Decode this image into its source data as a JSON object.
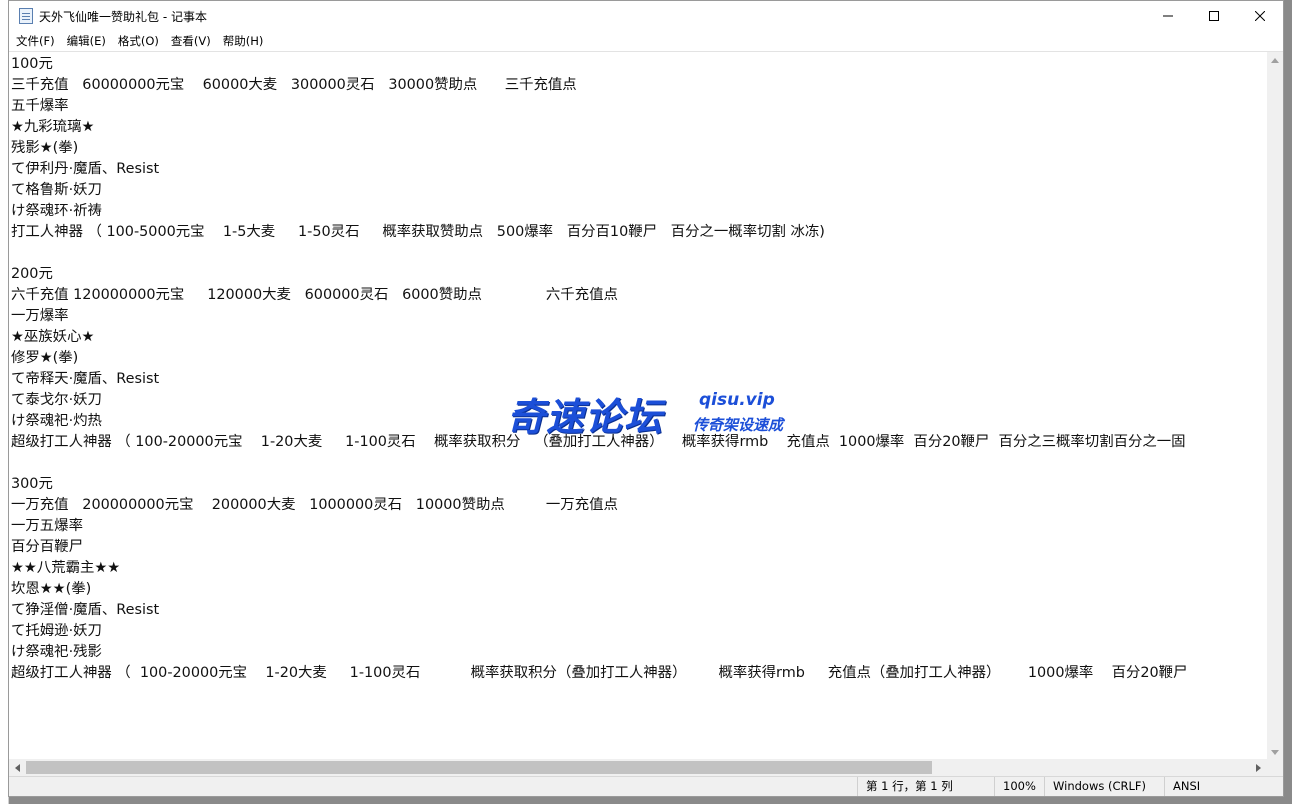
{
  "window": {
    "title": "天外飞仙唯一赞助礼包 - 记事本",
    "icon": "notepad-icon"
  },
  "menu": [
    "文件(F)",
    "编辑(E)",
    "格式(O)",
    "查看(V)",
    "帮助(H)"
  ],
  "editor": {
    "lines": [
      "100元",
      "三千充值   60000000元宝    60000大麦   300000灵石   30000赞助点      三千充值点",
      "五千爆率",
      "★九彩琉璃★",
      "残影★(拳)",
      "て伊利丹·魔盾、Resist",
      "て格鲁斯·妖刀",
      "け祭魂环·祈祷",
      "打工人神器 （ 100-5000元宝    1-5大麦     1-50灵石     概率获取赞助点   500爆率   百分百10鞭尸   百分之一概率切割 冰冻)",
      "",
      "200元",
      "六千充值 120000000元宝     120000大麦   600000灵石   6000赞助点              六千充值点",
      "一万爆率",
      "★巫族妖心★",
      "修罗★(拳)",
      "て帝释天·魔盾、Resist",
      "て泰戈尔·妖刀",
      "け祭魂祀·灼热",
      "超级打工人神器 （ 100-20000元宝    1-20大麦     1-100灵石    概率获取积分   （叠加打工人神器）    概率获得rmb    充值点  1000爆率  百分20鞭尸  百分之三概率切割百分之一固",
      "",
      "300元",
      "一万充值   200000000元宝    200000大麦   1000000灵石   10000赞助点         一万充值点",
      "一万五爆率",
      "百分百鞭尸",
      "★★八荒霸主★★",
      "坎恩★★(拳)",
      "て狰淫僧·魔盾、Resist",
      "て托姆逊·妖刀",
      "け祭魂祀·残影",
      "超级打工人神器 （  100-20000元宝    1-20大麦     1-100灵石           概率获取积分（叠加打工人神器）       概率获得rmb     充值点（叠加打工人神器）      1000爆率    百分20鞭尸"
    ]
  },
  "watermark": {
    "main": "奇速论坛",
    "url": "qisu.vip",
    "sub": "传奇架设速成"
  },
  "statusbar": {
    "position": "第 1 行，第 1 列",
    "zoom": "100%",
    "line_ending": "Windows (CRLF)",
    "encoding": "ANSI"
  },
  "scroll": {
    "horizontal_thumb_fraction": 0.74
  },
  "colors": {
    "watermark": "#1c4fd8",
    "status_bg": "#f0f0f0"
  }
}
